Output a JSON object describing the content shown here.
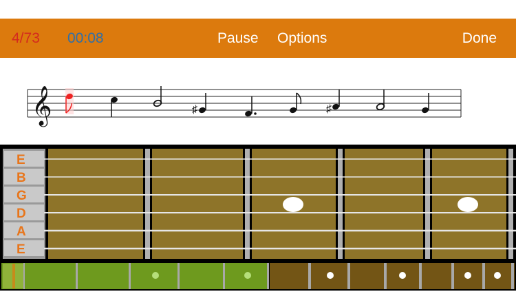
{
  "status": {
    "progress": "4/73",
    "elapsed": "00:08",
    "counter_color": "#d42a1e",
    "timer_color": "#2f6fa8"
  },
  "toolbar": {
    "pause_label": "Pause",
    "options_label": "Options",
    "done_label": "Done",
    "background": "#dc7a0d"
  },
  "staff": {
    "clef": "treble",
    "notes": [
      {
        "duration": "eighth",
        "accidental": "",
        "current": true
      },
      {
        "duration": "quarter",
        "accidental": "",
        "current": false
      },
      {
        "duration": "half",
        "accidental": "",
        "current": false
      },
      {
        "duration": "quarter",
        "accidental": "sharp",
        "current": false
      },
      {
        "duration": "dotted-quarter",
        "accidental": "",
        "current": false
      },
      {
        "duration": "eighth",
        "accidental": "",
        "current": false
      },
      {
        "duration": "quarter",
        "accidental": "sharp",
        "current": false
      },
      {
        "duration": "half",
        "accidental": "",
        "current": false
      },
      {
        "duration": "quarter",
        "accidental": "",
        "current": false
      }
    ]
  },
  "fretboard": {
    "string_labels": [
      "E",
      "B",
      "G",
      "D",
      "A",
      "E"
    ],
    "label_color": "#e8751a",
    "wood_color": "#8e7429",
    "markers": [
      {
        "fret": 3,
        "string": 3
      },
      {
        "fret": 5,
        "string": 3
      }
    ]
  },
  "navigator": {
    "highlight_color": "#6e9a1e",
    "neck_color": "#735515"
  }
}
